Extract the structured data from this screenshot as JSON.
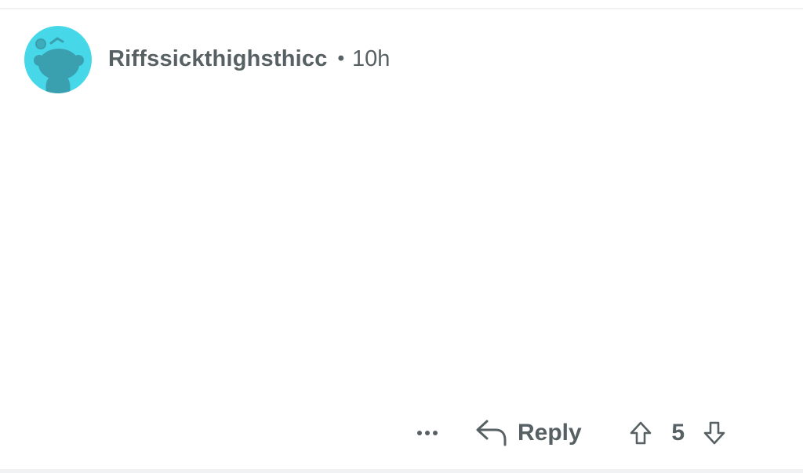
{
  "comment": {
    "author": "Riffssickthighsthicc",
    "separator": "•",
    "timestamp": "10h",
    "avatar_icon": "reddit-snoo-avatar-icon",
    "avatar_color": "#46d7e8"
  },
  "actions": {
    "more_icon": "more-options-icon",
    "reply_icon": "reply-arrow-icon",
    "reply_label": "Reply",
    "upvote_icon": "upvote-arrow-icon",
    "score": "5",
    "downvote_icon": "downvote-arrow-icon"
  },
  "colors": {
    "text": "#576063",
    "background": "#ffffff",
    "divider": "#f1f2f3"
  }
}
